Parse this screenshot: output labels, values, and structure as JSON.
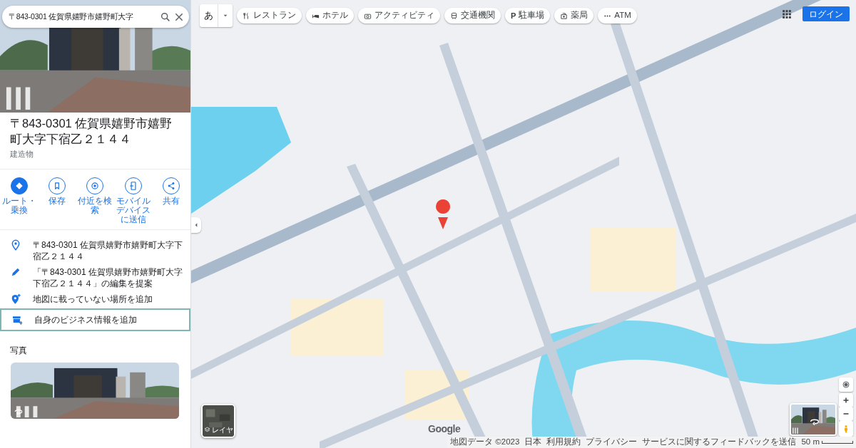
{
  "search": {
    "value": "〒843-0301 佐賀県嬉野市嬉野町大字"
  },
  "place": {
    "title": "〒843-0301 佐賀県嬉野市嬉野町大字下宿乙２１４４",
    "category": "建造物"
  },
  "actions": [
    {
      "kind": "route",
      "label": "ルート・乗換",
      "primary": true
    },
    {
      "kind": "save",
      "label": "保存",
      "primary": false
    },
    {
      "kind": "nearby",
      "label": "付近を検索",
      "primary": false
    },
    {
      "kind": "send",
      "label": "モバイルデバイスに送信",
      "primary": false
    },
    {
      "kind": "share",
      "label": "共有",
      "primary": false
    }
  ],
  "info_items": [
    {
      "kind": "pin",
      "text": "〒843-0301 佐賀県嬉野市嬉野町大字下宿乙２１４４",
      "selected": false
    },
    {
      "kind": "edit",
      "text": "「〒843-0301 佐賀県嬉野市嬉野町大字下宿乙２１４４」の編集を提案",
      "selected": false
    },
    {
      "kind": "add-place",
      "text": "地図に載っていない場所を追加",
      "selected": false
    },
    {
      "kind": "business",
      "text": "自身のビジネス情報を追加",
      "selected": true
    }
  ],
  "photos": {
    "heading": "写真"
  },
  "map": {
    "input_tool": "あ",
    "chips": [
      {
        "kind": "restaurant",
        "label": "レストラン"
      },
      {
        "kind": "hotel",
        "label": "ホテル"
      },
      {
        "kind": "activity",
        "label": "アクティビティ"
      },
      {
        "kind": "transit",
        "label": "交通機関"
      },
      {
        "kind": "parking",
        "icon_text": "P",
        "label": "駐車場"
      },
      {
        "kind": "pharmacy",
        "label": "薬局"
      },
      {
        "kind": "atm",
        "label": "ATM"
      }
    ],
    "login": "ログイン",
    "layers_label": "レイヤ",
    "logo": "Google",
    "footer": [
      "地図データ ©2023",
      "日本",
      "利用規約",
      "プライバシー",
      "サービスに関するフィードバックを送信"
    ],
    "scale": "50 m"
  }
}
